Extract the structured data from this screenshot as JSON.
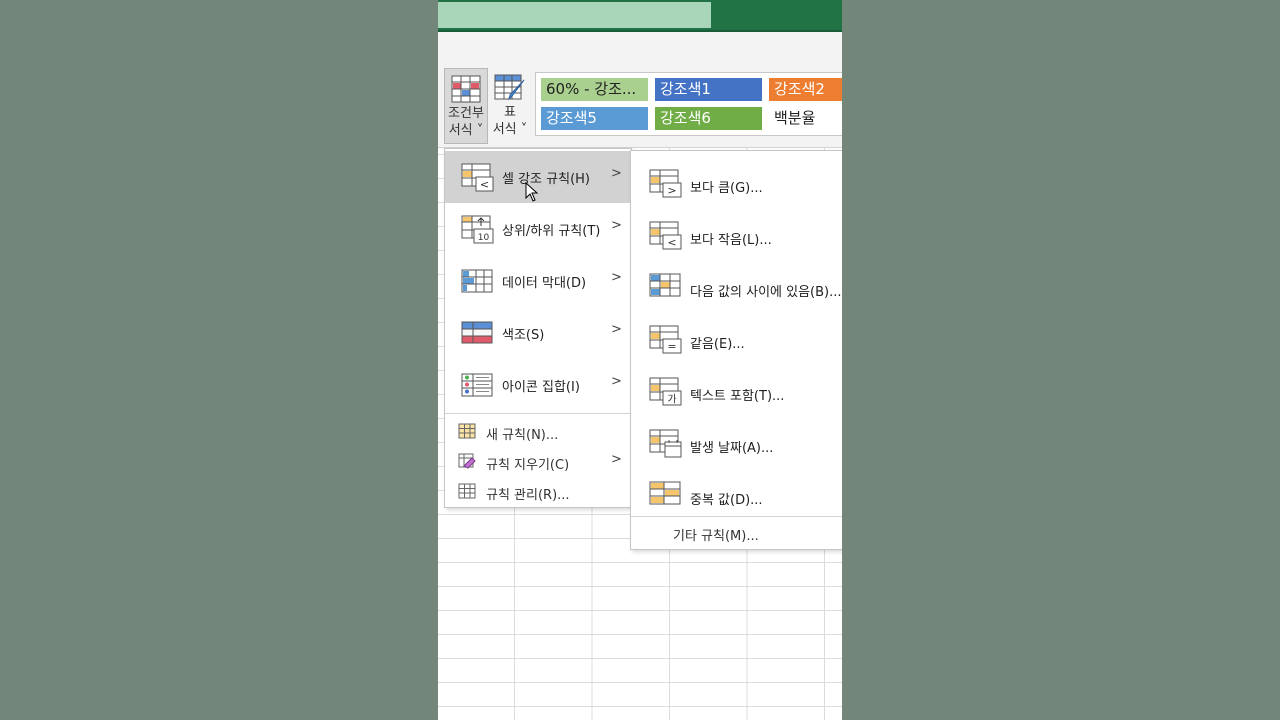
{
  "ribbon": {
    "conditional_format": {
      "line1": "조건부",
      "line2": "서식 ˅"
    },
    "format_as_table": {
      "line1": "표",
      "line2": "서식 ˅"
    },
    "cell_styles": [
      {
        "label": "60% - 강조...",
        "bg": "#a9d08e",
        "fg": "#222222"
      },
      {
        "label": "강조색1",
        "bg": "#4472c4",
        "fg": "#ffffff"
      },
      {
        "label": "강조색2",
        "bg": "#ed7d31",
        "fg": "#ffffff"
      },
      {
        "label": "강조색5",
        "bg": "#5b9bd5",
        "fg": "#ffffff"
      },
      {
        "label": "강조색6",
        "bg": "#70ad47",
        "fg": "#ffffff"
      },
      {
        "label": "백분율",
        "bg": "#ffffff",
        "fg": "#222222"
      }
    ]
  },
  "menu": {
    "items": [
      {
        "label": "셀 강조 규칙(H)",
        "icon": "highlight-cells-icon",
        "highlighted": true
      },
      {
        "label": "상위/하위 규칙(T)",
        "icon": "top-bottom-icon"
      },
      {
        "label": "데이터 막대(D)",
        "icon": "data-bars-icon"
      },
      {
        "label": "색조(S)",
        "icon": "color-scales-icon"
      },
      {
        "label": "아이콘 집합(I)",
        "icon": "icon-sets-icon"
      }
    ],
    "small_items": [
      {
        "label": "새 규칙(N)...",
        "icon": "new-rule-icon"
      },
      {
        "label": "규칙 지우기(C)",
        "icon": "clear-rules-icon"
      },
      {
        "label": "규칙 관리(R)...",
        "icon": "manage-rules-icon"
      }
    ]
  },
  "submenu": {
    "items": [
      {
        "label": "보다 큼(G)...",
        "icon": "greater-than-icon"
      },
      {
        "label": "보다 작음(L)...",
        "icon": "less-than-icon"
      },
      {
        "label": "다음 값의 사이에 있음(B)...",
        "icon": "between-icon"
      },
      {
        "label": "같음(E)...",
        "icon": "equal-to-icon"
      },
      {
        "label": "텍스트 포함(T)...",
        "icon": "text-contains-icon"
      },
      {
        "label": "발생 날짜(A)...",
        "icon": "date-occurring-icon"
      },
      {
        "label": "중복 값(D)...",
        "icon": "duplicate-values-icon"
      }
    ],
    "more_rules": "기타 규칙(M)..."
  },
  "icon_badges": {
    "greater_than": ">",
    "less_than": "<",
    "equal": "=",
    "text": "가",
    "top10": "10"
  },
  "colors": {
    "excel_green": "#217346",
    "menu_highlight": "#d2d2d2"
  }
}
